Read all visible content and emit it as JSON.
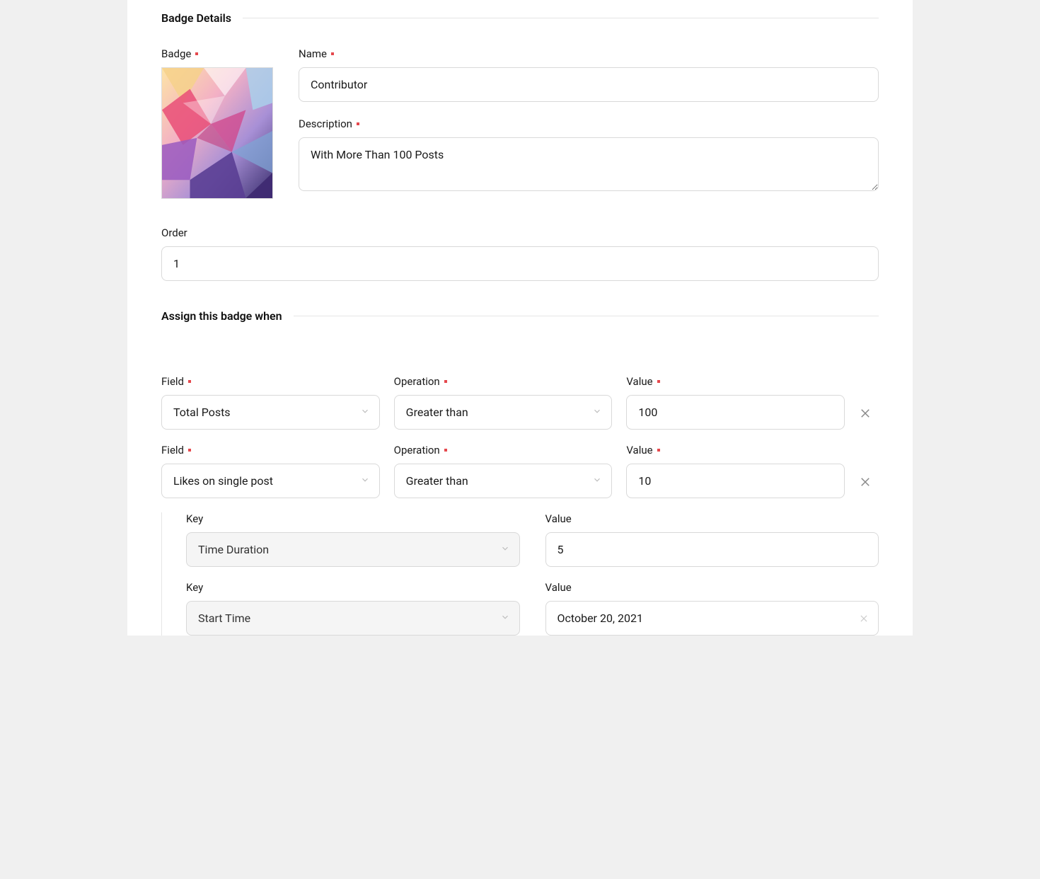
{
  "sections": {
    "badge_details": "Badge Details",
    "assign_when": "Assign this badge when"
  },
  "labels": {
    "badge": "Badge",
    "name": "Name",
    "description": "Description",
    "order": "Order",
    "field": "Field",
    "operation": "Operation",
    "value": "Value",
    "key": "Key"
  },
  "values": {
    "name": "Contributor",
    "description": "With More Than 100 Posts",
    "order": "1"
  },
  "rules": [
    {
      "field": "Total Posts",
      "operation": "Greater than",
      "value": "100"
    },
    {
      "field": "Likes on single post",
      "operation": "Greater than",
      "value": "10"
    }
  ],
  "sub_rules": [
    {
      "key": "Time Duration",
      "value": "5"
    },
    {
      "key": "Start Time",
      "value": "October 20, 2021"
    }
  ]
}
